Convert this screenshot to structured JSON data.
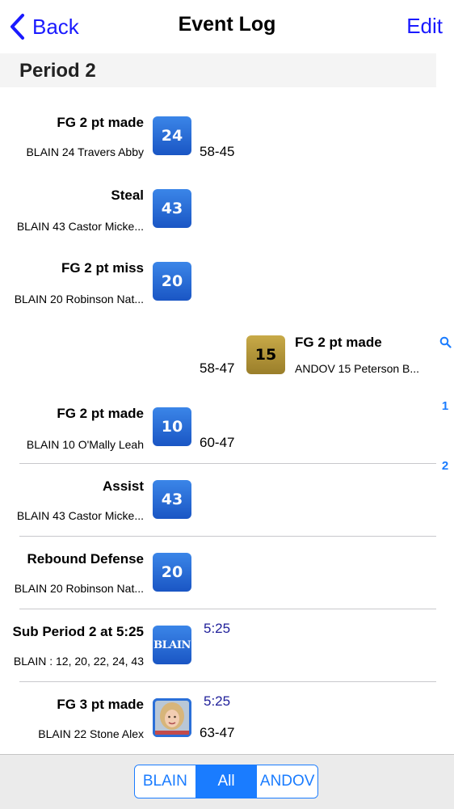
{
  "nav": {
    "back_label": "Back",
    "title": "Event Log",
    "edit_label": "Edit"
  },
  "section": {
    "title": "Period 2"
  },
  "events": [
    {
      "title": "FG 2 pt made",
      "detail": "BLAIN 24 Travers Abby",
      "badge": "24",
      "score": "58-45"
    },
    {
      "title": "Steal",
      "detail": "BLAIN 43 Castor Micke...",
      "badge": "43"
    },
    {
      "title": "FG 2 pt miss",
      "detail": "BLAIN 20 Robinson Nat...",
      "badge": "20"
    },
    {
      "title": "FG 2 pt made",
      "detail": "ANDOV 15 Peterson B...",
      "badge": "15",
      "score": "58-47"
    },
    {
      "title": "FG 2 pt made",
      "detail": "BLAIN 10 O'Mally Leah",
      "badge": "10",
      "score": "60-47"
    },
    {
      "title": "Assist",
      "detail": "BLAIN 43 Castor Micke...",
      "badge": "43"
    },
    {
      "title": "Rebound Defense",
      "detail": "BLAIN 20 Robinson Nat...",
      "badge": "20"
    },
    {
      "title": "Sub Period 2 at 5:25",
      "detail": "BLAIN : 12, 20, 22, 24, 43",
      "badge": "BLAIN",
      "time": "5:25"
    },
    {
      "title": "FG 3 pt made",
      "detail": "BLAIN 22 Stone Alex",
      "time": "5:25",
      "score": "63-47"
    }
  ],
  "index": [
    "1",
    "2"
  ],
  "filter": {
    "options": [
      "BLAIN",
      "All",
      "ANDOV"
    ],
    "selected": "All"
  },
  "colors": {
    "accent": "#1a7cff",
    "home_badge": "#2a6fd8",
    "away_badge": "#b39638",
    "time_text": "#20209a"
  },
  "icons": {
    "back": "chevron-left-icon",
    "index_search": "search-icon"
  }
}
